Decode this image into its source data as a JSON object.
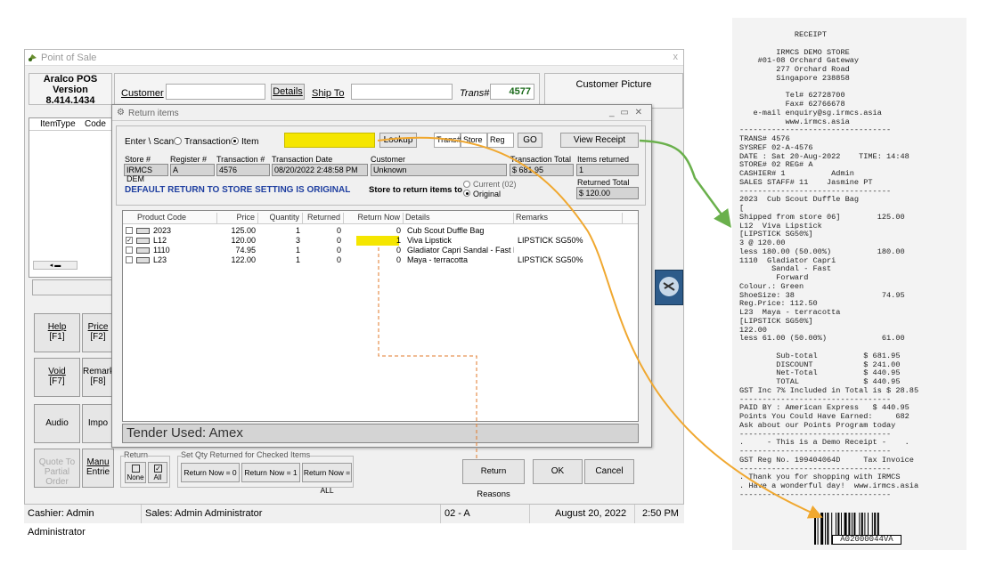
{
  "window": {
    "title": "Point of Sale",
    "close": "x"
  },
  "aralco": {
    "line1": "Aralco POS",
    "line2": "Version",
    "line3": "8.414.1434"
  },
  "header": {
    "customer": "Customer",
    "details": "Details",
    "ship_to": "Ship To",
    "trans_label": "Trans#",
    "trans_value": "4577",
    "customer_picture": "Customer Picture"
  },
  "left_grid": {
    "cols": [
      "Item",
      "Type",
      "Code"
    ]
  },
  "side_buttons": [
    {
      "a": "Help",
      "b": "[F1]"
    },
    {
      "a": "Price",
      "b": "[F2]"
    },
    {
      "a": "Void",
      "b": "[F7]"
    },
    {
      "a": "Remark",
      "b": "[F8]"
    },
    {
      "a": "Audio",
      "b": ""
    },
    {
      "a": "Impo",
      "b": ""
    },
    {
      "a": "Quote To",
      "b": "Partial Order"
    },
    {
      "a": "Manu",
      "b": "Entrie"
    }
  ],
  "dialog": {
    "title": "Return items",
    "controls": "_  ▭  ✕",
    "enter_scan": "Enter \\ Scan",
    "opt_transaction": "Transaction",
    "opt_item": "Item",
    "lookup": "Lookup",
    "trans_hash": "Trans#",
    "store": "Store",
    "reg": "Reg",
    "go": "GO",
    "view_receipt": "View Receipt",
    "lbl_store": "Store #",
    "lbl_register": "Register #",
    "lbl_transaction": "Transaction #",
    "lbl_date": "Transaction Date",
    "lbl_customer": "Customer",
    "lbl_total": "Transaction Total",
    "lbl_items_returned": "Items returned",
    "lbl_returned_total": "Returned Total",
    "val_store": "IRMCS DEM",
    "val_register": "A",
    "val_transaction": "4576",
    "val_date": "08/20/2022 2:48:58 PM",
    "val_customer": "Unknown",
    "val_total": "$ 681.95",
    "val_items_returned": "1",
    "val_returned_total": "$ 120.00",
    "default_return": "DEFAULT RETURN TO STORE SETTING IS ORIGINAL",
    "store_to_return": "Store to return items to",
    "opt_current": "Current (02)",
    "opt_original": "Original",
    "tender": "Tender Used: Amex",
    "return_group": "Return",
    "none": "None",
    "all": "All",
    "setqty_group": "Set Qty Returned for Checked Items",
    "rn0": "Return Now = 0",
    "rn1": "Return Now = 1",
    "rnall": "Return Now = ALL",
    "return_reasons": "Return Reasons",
    "ok": "OK",
    "cancel": "Cancel"
  },
  "table": {
    "headers": [
      "Product Code",
      "Price",
      "Quantity",
      "Returned",
      "Return Now",
      "Details",
      "Remarks"
    ],
    "rows": [
      {
        "checked": "",
        "code": "2023",
        "price": "125.00",
        "qty": "1",
        "returned": "0",
        "now": "0",
        "details": "Cub Scout Duffle Bag",
        "remarks": ""
      },
      {
        "checked": "✓",
        "code": "L12",
        "price": "120.00",
        "qty": "3",
        "returned": "0",
        "now": "1",
        "details": "Viva Lipstick",
        "remarks": "LIPSTICK SG50%"
      },
      {
        "checked": "",
        "code": "1110",
        "price": "74.95",
        "qty": "1",
        "returned": "0",
        "now": "0",
        "details": "Gladiator Capri Sandal - Fast F...",
        "remarks": ""
      },
      {
        "checked": "",
        "code": "L23",
        "price": "122.00",
        "qty": "1",
        "returned": "0",
        "now": "0",
        "details": "Maya - terracotta",
        "remarks": "LIPSTICK SG50%"
      }
    ]
  },
  "status": {
    "cashier": "Cashier: Admin Administrator",
    "sales": "Sales: Admin Administrator",
    "store_reg": "02 - A",
    "date": "August 20, 2022",
    "time": "2:50 PM"
  },
  "receipt": {
    "lines": [
      "            RECEIPT",
      "",
      "        IRMCS DEMO STORE",
      "    #01-08 Orchard Gateway",
      "        277 Orchard Road",
      "        Singapore 238858",
      "",
      "          Tel# 62728700",
      "          Fax# 62766678",
      "   e-mail enquiry@sg.irmcs.asia",
      "          www.irmcs.asia",
      "---------------------------------",
      "TRANS# 4576",
      "SYSREF 02-A-4576",
      "DATE : Sat 20-Aug-2022    TIME: 14:48",
      "STORE# 02 REG# A",
      "CASHIER# 1          Admin",
      "SALES STAFF# 11    Jasmine PT",
      "---------------------------------",
      "2023  Cub Scout Duffle Bag",
      "[",
      "Shipped from store 06]        125.00",
      "L12  Viva Lipstick",
      "[LIPSTICK SG50%]",
      "3 @ 120.00",
      "less 180.00 (50.00%)          180.00",
      "1110  Gladiator Capri",
      "       Sandal - Fast",
      "        Forward",
      "Colour.: Green",
      "ShoeSize: 38                   74.95",
      "Reg.Price: 112.50",
      "L23  Maya - terracotta",
      "[LIPSTICK SG50%]",
      "122.00",
      "less 61.00 (50.00%)            61.00",
      "",
      "        Sub-total          $ 681.95",
      "        DISCOUNT           $ 241.00",
      "        Net-Total          $ 440.95",
      "        TOTAL              $ 440.95",
      "GST Inc 7% Included in Total is $ 28.85",
      "---------------------------------",
      "PAID BY : American Express   $ 440.95",
      "Points You Could Have Earned:     682",
      "Ask about our Points Program today",
      "---------------------------------",
      ".     - This is a Demo Receipt -    .",
      "---------------------------------",
      "GST Reg No. 199404064D     Tax Invoice",
      "---------------------------------",
      ". Thank you for shopping with IRMCS",
      ". Have a wonderful day!  www.irmcs.asia",
      "---------------------------------"
    ],
    "barcode": "A02000044VA"
  },
  "colors": {
    "highlight": "#f5e600",
    "accent_blue": "#1f3fa0",
    "arrow_green": "#6ab04c",
    "arrow_orange": "#f0a830"
  }
}
